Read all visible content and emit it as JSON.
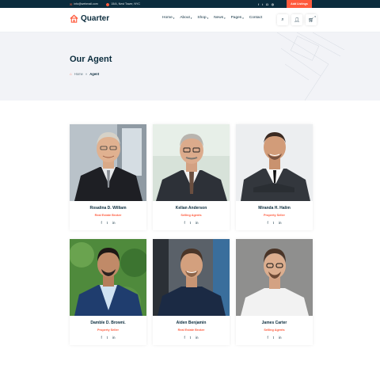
{
  "topbar": {
    "email": "info@webmail.com",
    "address": "15/A, Nest Tower, NYC",
    "social": [
      "facebook-icon",
      "twitter-icon",
      "instagram-icon",
      "dribbble-icon"
    ],
    "add_listing": "Add Listings"
  },
  "header": {
    "logo_text": "Quarter",
    "nav": [
      {
        "label": "Home",
        "dropdown": true
      },
      {
        "label": "About",
        "dropdown": true
      },
      {
        "label": "Shop",
        "dropdown": true
      },
      {
        "label": "News",
        "dropdown": true
      },
      {
        "label": "Pages",
        "dropdown": true
      },
      {
        "label": "Contact",
        "dropdown": false
      }
    ],
    "cart_count": "0"
  },
  "banner": {
    "title": "Our Agent",
    "breadcrumb_home": "Home",
    "breadcrumb_sep": "»",
    "breadcrumb_current": "Agent"
  },
  "agents": [
    {
      "name": "Rosalina D. William",
      "role": "Real Estate Broker"
    },
    {
      "name": "Kelian Anderson",
      "role": "Selling Agents"
    },
    {
      "name": "Miranda H. Halim",
      "role": "Property Seller"
    },
    {
      "name": "Damble D. Browni.",
      "role": "Property Seller"
    },
    {
      "name": "Aiden Benjamin",
      "role": "Real Estate Broker"
    },
    {
      "name": "James Carter",
      "role": "Selling Agents"
    }
  ],
  "colors": {
    "accent": "#ff5a3c",
    "navy": "#0b2c3d",
    "banner_bg": "#f2f3f7"
  }
}
